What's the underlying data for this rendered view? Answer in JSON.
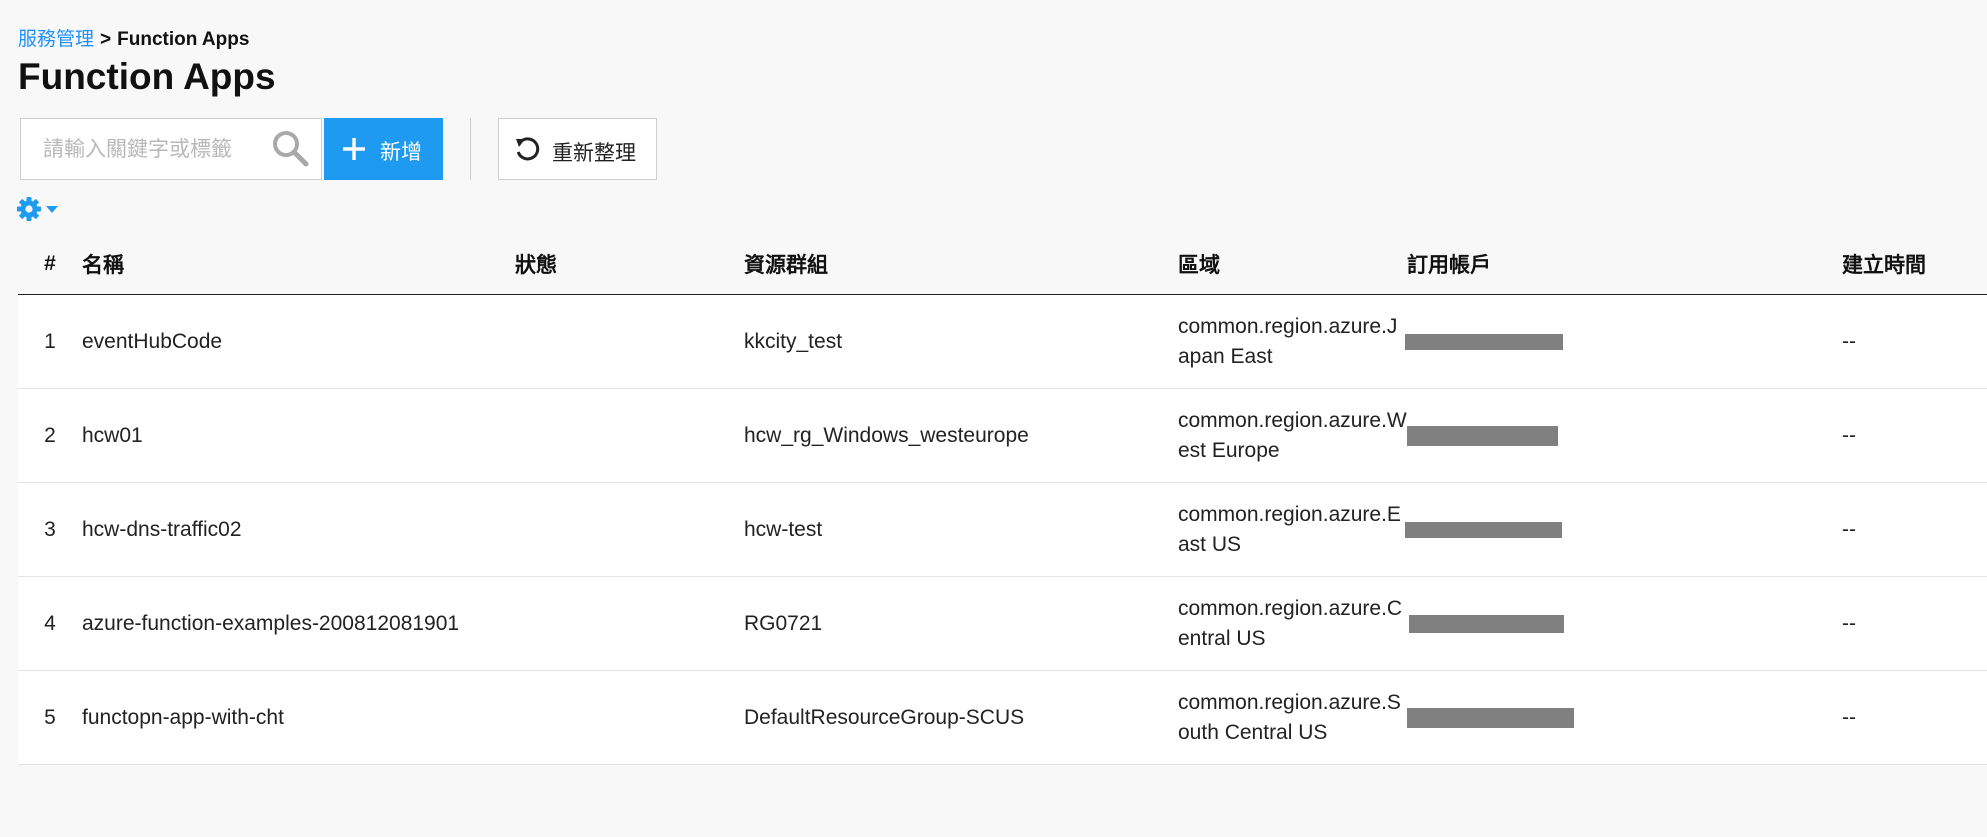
{
  "breadcrumb": {
    "parent": "服務管理",
    "separator": ">",
    "current": "Function Apps"
  },
  "page": {
    "title": "Function Apps"
  },
  "toolbar": {
    "search_placeholder": "請輸入關鍵字或標籤",
    "search_value": "",
    "add_label": "新增",
    "refresh_label": "重新整理"
  },
  "icons": {
    "search": "search-icon",
    "add": "plus-icon",
    "refresh": "refresh-icon",
    "settings": "gear-icon",
    "dropdown": "caret-down-icon"
  },
  "colors": {
    "accent": "#1e9bf0",
    "link": "#1e90ff",
    "redaction": "#808080"
  },
  "table": {
    "headers": {
      "num": "#",
      "name": "名稱",
      "status": "狀態",
      "group": "資源群組",
      "region": "區域",
      "subscription": "訂用帳戶",
      "created": "建立時間"
    },
    "rows": [
      {
        "num": "1",
        "name": "eventHubCode",
        "status": "",
        "group": "kkcity_test",
        "region": "common.region.azure.Japan East",
        "subscription": "[redacted]",
        "created": "--"
      },
      {
        "num": "2",
        "name": "hcw01",
        "status": "",
        "group": "hcw_rg_Windows_westeurope",
        "region": "common.region.azure.West Europe",
        "subscription": "[redacted]",
        "created": "--"
      },
      {
        "num": "3",
        "name": "hcw-dns-traffic02",
        "status": "",
        "group": "hcw-test",
        "region": "common.region.azure.East US",
        "subscription": "[redacted]",
        "created": "--"
      },
      {
        "num": "4",
        "name": "azure-function-examples-200812081901",
        "status": "",
        "group": "RG0721",
        "region": "common.region.azure.Central US",
        "subscription": "[redacted]",
        "created": "--"
      },
      {
        "num": "5",
        "name": "functopn-app-with-cht",
        "status": "",
        "group": "DefaultResourceGroup-SCUS",
        "region": "common.region.azure.South Central US",
        "subscription": "[redacted]",
        "created": "--"
      }
    ]
  }
}
